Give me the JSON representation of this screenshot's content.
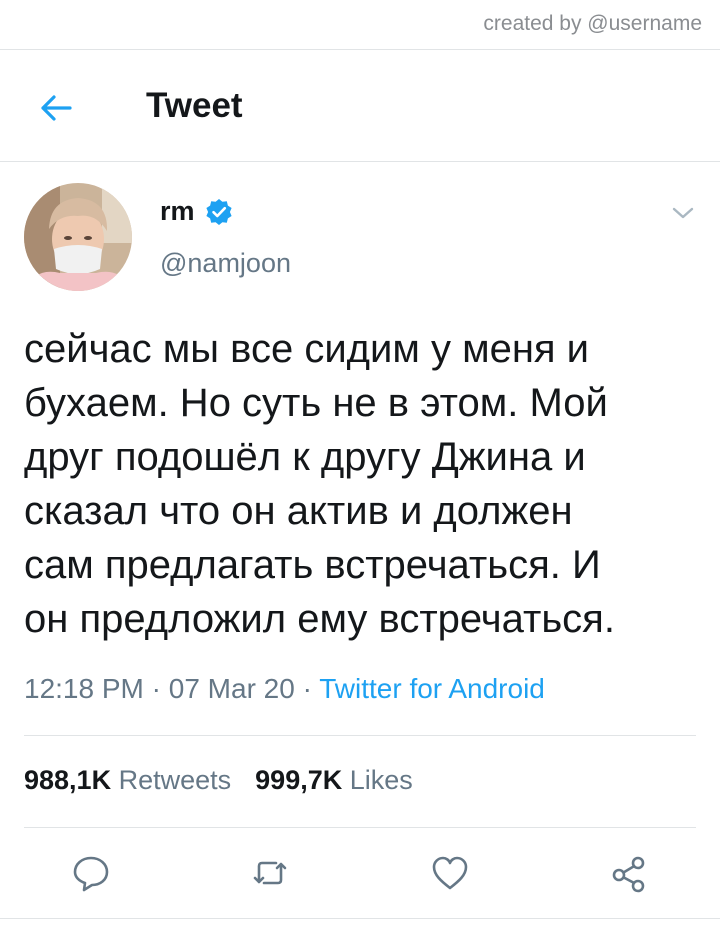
{
  "credit": "created by @username",
  "header": {
    "title": "Tweet",
    "back_icon": "arrow-left-icon"
  },
  "tweet": {
    "display_name": "rm",
    "verified": true,
    "handle": "@namjoon",
    "text": "сейчас мы все сидим у меня и\nбухаем. Но суть не в этом. Мой\nдруг подошёл к другу Джина и\nсказал что он актив и должен\nсам предлагать встречаться. И\nон предложил ему встречаться.",
    "time": "12:18 PM",
    "date": "07 Mar 20",
    "separator": " · ",
    "source": "Twitter for Android"
  },
  "stats": {
    "retweets_count": "988,1K",
    "retweets_label": "Retweets",
    "likes_count": "999,7K",
    "likes_label": "Likes"
  },
  "actions": [
    "reply-icon",
    "retweet-icon",
    "like-icon",
    "share-icon"
  ],
  "colors": {
    "accent": "#1da1f2",
    "text": "#14171a",
    "secondary": "#657786",
    "divider": "#e1e4e6"
  }
}
